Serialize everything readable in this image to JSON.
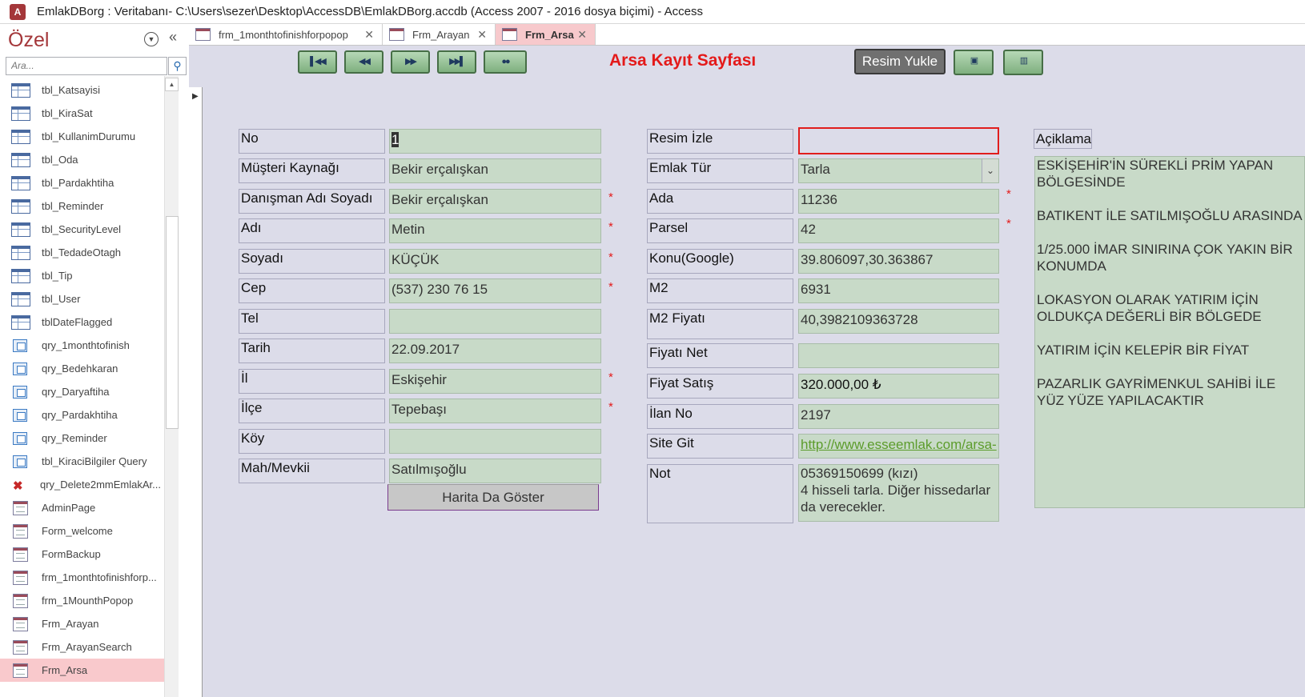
{
  "window": {
    "title": "EmlakDBorg : Veritabanı- C:\\Users\\sezer\\Desktop\\AccessDB\\EmlakDBorg.accdb (Access 2007 - 2016 dosya biçimi) - Access",
    "app_icon_letter": "A"
  },
  "nav_pane": {
    "title": "Özel",
    "search_placeholder": "Ara...",
    "items": [
      {
        "type": "table",
        "label": "tbl_Katsayisi"
      },
      {
        "type": "table",
        "label": "tbl_KiraSat"
      },
      {
        "type": "table",
        "label": "tbl_KullanimDurumu"
      },
      {
        "type": "table",
        "label": "tbl_Oda"
      },
      {
        "type": "table",
        "label": "tbl_Pardakhtiha"
      },
      {
        "type": "table",
        "label": "tbl_Reminder"
      },
      {
        "type": "table",
        "label": "tbl_SecurityLevel"
      },
      {
        "type": "table",
        "label": "tbl_TedadeOtagh"
      },
      {
        "type": "table",
        "label": "tbl_Tip"
      },
      {
        "type": "table",
        "label": "tbl_User"
      },
      {
        "type": "table",
        "label": "tblDateFlagged"
      },
      {
        "type": "query",
        "label": "qry_1monthtofinish"
      },
      {
        "type": "query",
        "label": "qry_Bedehkaran"
      },
      {
        "type": "query",
        "label": "qry_Daryaftiha"
      },
      {
        "type": "query",
        "label": "qry_Pardakhtiha"
      },
      {
        "type": "query",
        "label": "qry_Reminder"
      },
      {
        "type": "query",
        "label": "tbl_KiraciBilgiler Query"
      },
      {
        "type": "delete",
        "label": "qry_Delete2mmEmlakAr..."
      },
      {
        "type": "form",
        "label": "AdminPage"
      },
      {
        "type": "form",
        "label": "Form_welcome"
      },
      {
        "type": "form",
        "label": "FormBackup"
      },
      {
        "type": "form",
        "label": "frm_1monthtofinishforp..."
      },
      {
        "type": "form",
        "label": "frm_1MounthPopop"
      },
      {
        "type": "form",
        "label": "Frm_Arayan"
      },
      {
        "type": "form",
        "label": "Frm_ArayanSearch"
      },
      {
        "type": "form",
        "label": "Frm_Arsa",
        "selected": true
      }
    ]
  },
  "tabs": [
    {
      "label": "frm_1monthtofinishforpopop"
    },
    {
      "label": "Frm_Arayan"
    },
    {
      "label": "Frm_Arsa",
      "active": true
    }
  ],
  "form": {
    "title": "Arsa Kayıt Sayfası",
    "upload_button": "Resim Yukle",
    "map_button": "Harita Da Göster",
    "description_label": "Açiklama",
    "description_text": "ESKİŞEHİR'İN SÜREKLİ PRİM YAPAN BÖLGESİNDE\n\nBATIKENT İLE SATILMIŞOĞLU ARASINDA\n\n1/25.000 İMAR SINIRINA ÇOK YAKIN BİR KONUMDA\n\nLOKASYON OLARAK YATIRIM İÇİN OLDUKÇA DEĞERLİ BİR BÖLGEDE\n\nYATIRIM İÇİN KELEPİR BİR FİYAT\n\nPAZARLIK GAYRİMENKUL SAHİBİ İLE YÜZ YÜZE YAPILACAKTIR",
    "left_fields": [
      {
        "label": "No",
        "value": "1",
        "required": false
      },
      {
        "label": "Müşteri Kaynağı",
        "value": "Bekir erçalışkan",
        "required": false
      },
      {
        "label": "Danışman Adı Soyadı",
        "value": "Bekir erçalışkan",
        "required": true
      },
      {
        "label": "Adı",
        "value": "Metin",
        "required": true
      },
      {
        "label": "Soyadı",
        "value": "KÜÇÜK",
        "required": true
      },
      {
        "label": "Cep",
        "value": "(537) 230 76 15",
        "required": true
      },
      {
        "label": "Tel",
        "value": "",
        "required": false
      },
      {
        "label": "Tarih",
        "value": "22.09.2017",
        "required": false
      },
      {
        "label": "İl",
        "value": "Eskişehir",
        "required": true
      },
      {
        "label": "İlçe",
        "value": "Tepebaşı",
        "required": true
      },
      {
        "label": "Köy",
        "value": "",
        "required": false
      },
      {
        "label": "Mah/Mevkii",
        "value": "Satılmışoğlu",
        "required": false
      }
    ],
    "right_fields": [
      {
        "label": "Resim İzle",
        "value": ""
      },
      {
        "label": "Emlak Tür",
        "value": "Tarla"
      },
      {
        "label": "Ada",
        "value": "11236",
        "required": true
      },
      {
        "label": "Parsel",
        "value": "42",
        "required": true
      },
      {
        "label": "Konu(Google)",
        "value": "39.806097,30.363867"
      },
      {
        "label": "M2",
        "value": "6931"
      },
      {
        "label": "M2 Fiyatı",
        "value": "40,3982109363728"
      },
      {
        "label": "Fiyatı Net",
        "value": ""
      },
      {
        "label": "Fiyat Satış",
        "value": "320.000,00 ₺"
      },
      {
        "label": "İlan No",
        "value": "2197"
      },
      {
        "label": "Site Git",
        "value": "http://www.esseemlak.com/arsa-"
      },
      {
        "label": "Not",
        "value": "05369150699 (kızı)\n4 hisseli tarla. Diğer hissedarlar da verecekler."
      }
    ]
  },
  "colors": {
    "title_red": "#e41a1a",
    "access_brand": "#a4373a",
    "field_bg": "#c8dac8",
    "form_bg": "#dcdce9"
  }
}
